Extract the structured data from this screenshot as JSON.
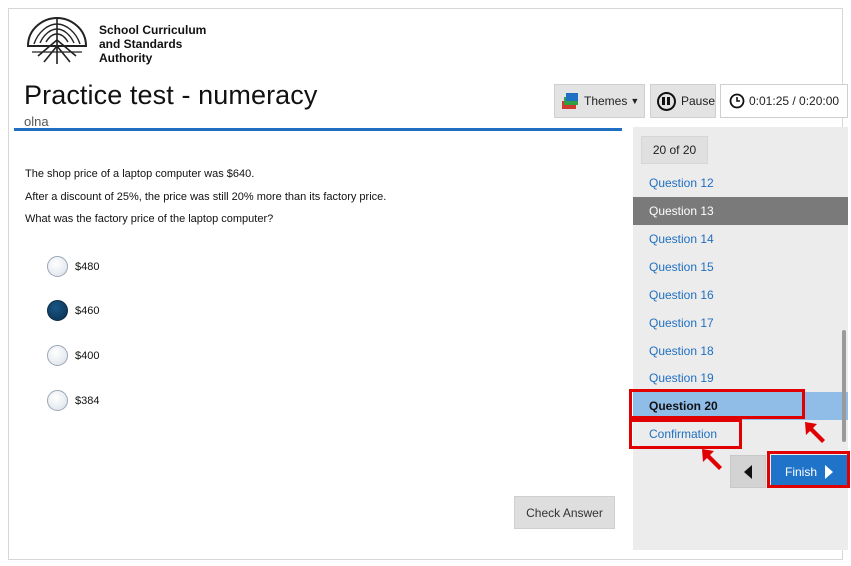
{
  "header": {
    "org_line1": "School Curriculum",
    "org_line2": "and Standards",
    "org_line3": "Authority",
    "title": "Practice test - numeracy",
    "subtitle": "olna"
  },
  "toolbar": {
    "themes_label": "Themes",
    "pause_label": "Pause",
    "timer_text": "0:01:25 / 0:20:00"
  },
  "question": {
    "line1": "The shop price of a laptop computer was $640.",
    "line2": "After a discount of 25%, the price was still 20% more than its factory price.",
    "line3": "What was the factory price of the laptop computer?",
    "options": [
      {
        "label": "$480",
        "selected": false
      },
      {
        "label": "$460",
        "selected": true
      },
      {
        "label": "$400",
        "selected": false
      },
      {
        "label": "$384",
        "selected": false
      }
    ],
    "check_answer_label": "Check Answer"
  },
  "sidebar": {
    "counter": "20 of 20",
    "items": [
      {
        "label": "Question 12",
        "state": "link"
      },
      {
        "label": "Question 13",
        "state": "dark"
      },
      {
        "label": "Question 14",
        "state": "link"
      },
      {
        "label": "Question 15",
        "state": "link"
      },
      {
        "label": "Question 16",
        "state": "link"
      },
      {
        "label": "Question 17",
        "state": "link"
      },
      {
        "label": "Question 18",
        "state": "link"
      },
      {
        "label": "Question 19",
        "state": "link"
      },
      {
        "label": "Question 20",
        "state": "current"
      },
      {
        "label": "Confirmation",
        "state": "link"
      }
    ],
    "finish_label": "Finish"
  },
  "colors": {
    "accent": "#1f74c9",
    "highlight": "#e00000",
    "current_item": "#8fbde8",
    "dark_item": "#7a7a7a",
    "selected_radio": "#0f3a5e"
  },
  "icons": [
    "tree-logo-icon",
    "themes-icon",
    "chevron-down-icon",
    "pause-icon",
    "clock-icon",
    "chevron-left-icon",
    "chevron-right-icon",
    "red-arrow-icon"
  ]
}
